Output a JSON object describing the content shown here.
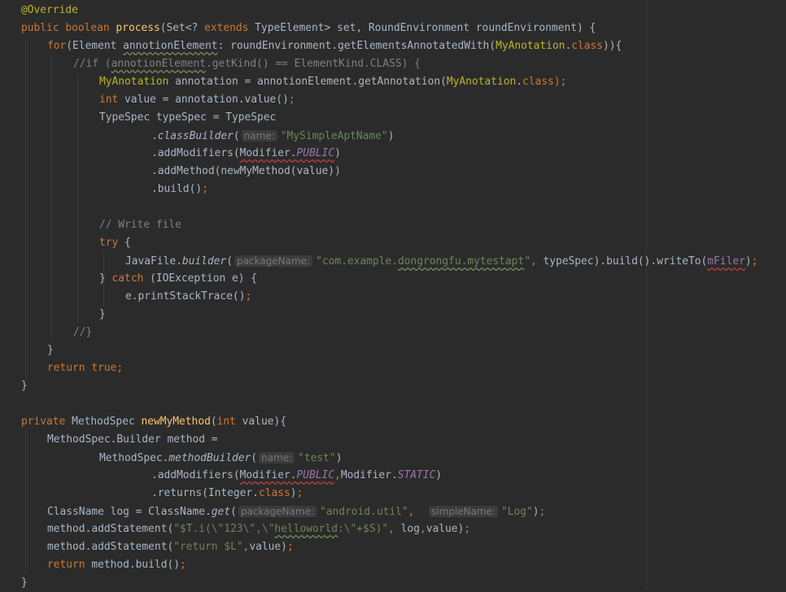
{
  "editor": {
    "lines": [
      {
        "indent": 0,
        "tokens": [
          {
            "t": "@Override",
            "c": "ann"
          }
        ]
      },
      {
        "indent": 0,
        "tokens": [
          {
            "t": "public boolean ",
            "c": "kw"
          },
          {
            "t": "process",
            "c": "fn"
          },
          {
            "t": "(Set<? ",
            "c": "pl"
          },
          {
            "t": "extends ",
            "c": "kw"
          },
          {
            "t": "TypeElement> set, RoundEnvironment roundEnvironment) {",
            "c": "pl"
          }
        ]
      },
      {
        "indent": 1,
        "tokens": [
          {
            "t": "for",
            "c": "kw"
          },
          {
            "t": "(Element ",
            "c": "pl"
          },
          {
            "t": "annotionElement",
            "c": "pl typo"
          },
          {
            "t": ": roundEnvironment.getElementsAnnotatedWith(",
            "c": "pl"
          },
          {
            "t": "MyAnotation",
            "c": "ann"
          },
          {
            "t": ".",
            "c": "pl"
          },
          {
            "t": "class",
            "c": "kw"
          },
          {
            "t": ")){",
            "c": "pl"
          }
        ]
      },
      {
        "indent": 2,
        "tokens": [
          {
            "t": "//if (",
            "c": "cm"
          },
          {
            "t": "annotionElement",
            "c": "cm typo"
          },
          {
            "t": ".getKind() == ElementKind.CLASS) {",
            "c": "cm"
          }
        ]
      },
      {
        "indent": 3,
        "tokens": [
          {
            "t": "MyAnotation",
            "c": "ann"
          },
          {
            "t": " annotation = annotionElement.getAnnotation(",
            "c": "pl"
          },
          {
            "t": "MyAnotation",
            "c": "ann"
          },
          {
            "t": ".",
            "c": "pl"
          },
          {
            "t": "class",
            "c": "kw"
          },
          {
            "t": ");",
            "c": "kw"
          }
        ]
      },
      {
        "indent": 3,
        "tokens": [
          {
            "t": "int ",
            "c": "kw"
          },
          {
            "t": "value = annotation.value()",
            "c": "pl"
          },
          {
            "t": ";",
            "c": "kw"
          }
        ]
      },
      {
        "indent": 3,
        "tokens": [
          {
            "t": "TypeSpec typeSpec = TypeSpec",
            "c": "pl"
          }
        ]
      },
      {
        "indent": 5,
        "tokens": [
          {
            "t": ".",
            "c": "pl"
          },
          {
            "t": "classBuilder",
            "c": "pl it"
          },
          {
            "t": "(",
            "c": "pl"
          },
          {
            "t": "name:",
            "c": "hint"
          },
          {
            "t": "\"MySimpleAptName\"",
            "c": "str"
          },
          {
            "t": ")",
            "c": "pl"
          }
        ]
      },
      {
        "indent": 5,
        "tokens": [
          {
            "t": ".addModifiers(",
            "c": "pl"
          },
          {
            "t": "Modifier.",
            "c": "pl err"
          },
          {
            "t": "PUBLIC",
            "c": "field it err"
          },
          {
            "t": ")",
            "c": "pl"
          }
        ]
      },
      {
        "indent": 5,
        "tokens": [
          {
            "t": ".addMethod(newMyMethod(value))",
            "c": "pl"
          }
        ]
      },
      {
        "indent": 5,
        "tokens": [
          {
            "t": ".build()",
            "c": "pl"
          },
          {
            "t": ";",
            "c": "kw"
          }
        ]
      },
      {
        "indent": 3,
        "tokens": []
      },
      {
        "indent": 3,
        "tokens": [
          {
            "t": "// Write file",
            "c": "cm"
          }
        ]
      },
      {
        "indent": 3,
        "tokens": [
          {
            "t": "try ",
            "c": "kw"
          },
          {
            "t": "{",
            "c": "pl"
          }
        ]
      },
      {
        "indent": 4,
        "tokens": [
          {
            "t": "JavaFile.",
            "c": "pl"
          },
          {
            "t": "builder",
            "c": "pl it"
          },
          {
            "t": "(",
            "c": "pl"
          },
          {
            "t": "packageName:",
            "c": "hint"
          },
          {
            "t": "\"com.example.",
            "c": "str"
          },
          {
            "t": "dongrongfu.mytestapt",
            "c": "str typo"
          },
          {
            "t": "\"",
            "c": "str"
          },
          {
            "t": ", ",
            "c": "kw"
          },
          {
            "t": "typeSpec).build().writeTo(",
            "c": "pl"
          },
          {
            "t": "mFiler",
            "c": "field err"
          },
          {
            "t": ")",
            "c": "pl"
          },
          {
            "t": ";",
            "c": "kw"
          }
        ]
      },
      {
        "indent": 3,
        "tokens": [
          {
            "t": "} ",
            "c": "pl"
          },
          {
            "t": "catch ",
            "c": "kw"
          },
          {
            "t": "(IOException e) {",
            "c": "pl"
          }
        ]
      },
      {
        "indent": 4,
        "tokens": [
          {
            "t": "e.printStackTrace()",
            "c": "pl"
          },
          {
            "t": ";",
            "c": "kw"
          }
        ]
      },
      {
        "indent": 3,
        "tokens": [
          {
            "t": "}",
            "c": "pl"
          }
        ]
      },
      {
        "indent": 2,
        "tokens": [
          {
            "t": "//}",
            "c": "cm"
          }
        ]
      },
      {
        "indent": 1,
        "tokens": [
          {
            "t": "}",
            "c": "pl"
          }
        ]
      },
      {
        "indent": 1,
        "tokens": [
          {
            "t": "return true",
            "c": "kw"
          },
          {
            "t": ";",
            "c": "kw"
          }
        ]
      },
      {
        "indent": 0,
        "tokens": [
          {
            "t": "}",
            "c": "pl"
          }
        ]
      },
      {
        "indent": 0,
        "tokens": []
      },
      {
        "indent": 0,
        "tokens": [
          {
            "t": "private ",
            "c": "kw"
          },
          {
            "t": "MethodSpec ",
            "c": "pl"
          },
          {
            "t": "newMyMethod",
            "c": "fn"
          },
          {
            "t": "(",
            "c": "pl"
          },
          {
            "t": "int ",
            "c": "kw"
          },
          {
            "t": "value){",
            "c": "pl"
          }
        ]
      },
      {
        "indent": 1,
        "tokens": [
          {
            "t": "MethodSpec.Builder method =",
            "c": "pl"
          }
        ]
      },
      {
        "indent": 3,
        "tokens": [
          {
            "t": "MethodSpec.",
            "c": "pl"
          },
          {
            "t": "methodBuilder",
            "c": "pl it"
          },
          {
            "t": "(",
            "c": "pl"
          },
          {
            "t": "name:",
            "c": "hint"
          },
          {
            "t": "\"test\"",
            "c": "str"
          },
          {
            "t": ")",
            "c": "pl"
          }
        ]
      },
      {
        "indent": 5,
        "tokens": [
          {
            "t": ".addModifiers(",
            "c": "pl"
          },
          {
            "t": "Modifier.",
            "c": "pl err"
          },
          {
            "t": "PUBLIC",
            "c": "field it err"
          },
          {
            "t": ",",
            "c": "kw"
          },
          {
            "t": "Modifier.",
            "c": "pl"
          },
          {
            "t": "STATIC",
            "c": "field it"
          },
          {
            "t": ")",
            "c": "pl"
          }
        ]
      },
      {
        "indent": 5,
        "tokens": [
          {
            "t": ".returns(Integer.",
            "c": "pl"
          },
          {
            "t": "class",
            "c": "kw"
          },
          {
            "t": ")",
            "c": "pl"
          },
          {
            "t": ";",
            "c": "kw"
          }
        ]
      },
      {
        "indent": 1,
        "tokens": [
          {
            "t": "ClassName log = ClassName.",
            "c": "pl"
          },
          {
            "t": "get",
            "c": "pl it"
          },
          {
            "t": "(",
            "c": "pl"
          },
          {
            "t": "packageName:",
            "c": "hint"
          },
          {
            "t": "\"android.util\"",
            "c": "str"
          },
          {
            "t": ",  ",
            "c": "kw"
          },
          {
            "t": "simpleName:",
            "c": "hint"
          },
          {
            "t": "\"Log\"",
            "c": "str"
          },
          {
            "t": ")",
            "c": "pl"
          },
          {
            "t": ";",
            "c": "kw"
          }
        ]
      },
      {
        "indent": 1,
        "tokens": [
          {
            "t": "method.addStatement(",
            "c": "pl"
          },
          {
            "t": "\"$T.i(\\\"123\\\",\\\"",
            "c": "str"
          },
          {
            "t": "helloworld",
            "c": "str typo"
          },
          {
            "t": ":\\\"+$S)\"",
            "c": "str"
          },
          {
            "t": ", ",
            "c": "kw"
          },
          {
            "t": "log",
            "c": "pl"
          },
          {
            "t": ",",
            "c": "kw"
          },
          {
            "t": "value)",
            "c": "pl"
          },
          {
            "t": ";",
            "c": "kw"
          }
        ]
      },
      {
        "indent": 1,
        "tokens": [
          {
            "t": "method.addStatement(",
            "c": "pl"
          },
          {
            "t": "\"return $L\"",
            "c": "str"
          },
          {
            "t": ",",
            "c": "kw"
          },
          {
            "t": "value)",
            "c": "pl"
          },
          {
            "t": ";",
            "c": "kw"
          }
        ]
      },
      {
        "indent": 1,
        "tokens": [
          {
            "t": "return ",
            "c": "kw"
          },
          {
            "t": "method.build()",
            "c": "pl"
          },
          {
            "t": ";",
            "c": "kw"
          }
        ]
      },
      {
        "indent": 0,
        "tokens": [
          {
            "t": "}",
            "c": "pl"
          }
        ]
      }
    ]
  }
}
